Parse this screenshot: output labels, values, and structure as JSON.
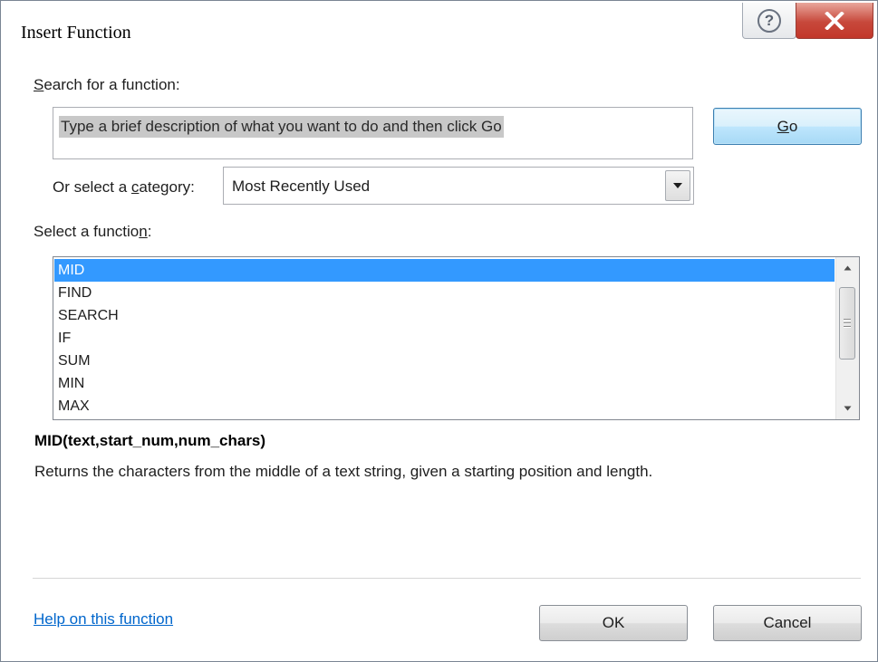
{
  "window": {
    "title": "Insert Function",
    "help_icon": "question-mark-icon",
    "close_icon": "close-x-icon"
  },
  "search": {
    "label_prefix": "",
    "label_access": "S",
    "label_rest": "earch for a function:",
    "input_value": "Type a brief description of what you want to do and then click Go",
    "go_button_access": "G",
    "go_button_rest": "o"
  },
  "category": {
    "label_before": "Or select a ",
    "label_access": "c",
    "label_after": "ategory:",
    "selected_value": "Most Recently Used"
  },
  "function_list": {
    "label_before": "Select a functio",
    "label_access": "n",
    "label_after": ":",
    "items": [
      "MID",
      "FIND",
      "SEARCH",
      "IF",
      "SUM",
      "MIN",
      "MAX"
    ],
    "selected_index": 0
  },
  "details": {
    "signature": "MID(text,start_num,num_chars)",
    "description": "Returns the characters from the middle of a text string, given a starting position and length."
  },
  "footer": {
    "help_link": "Help on this function",
    "ok_label": "OK",
    "cancel_label": "Cancel"
  },
  "colors": {
    "selection": "#3399ff",
    "link": "#0066cc",
    "close_button": "#c7483b"
  }
}
